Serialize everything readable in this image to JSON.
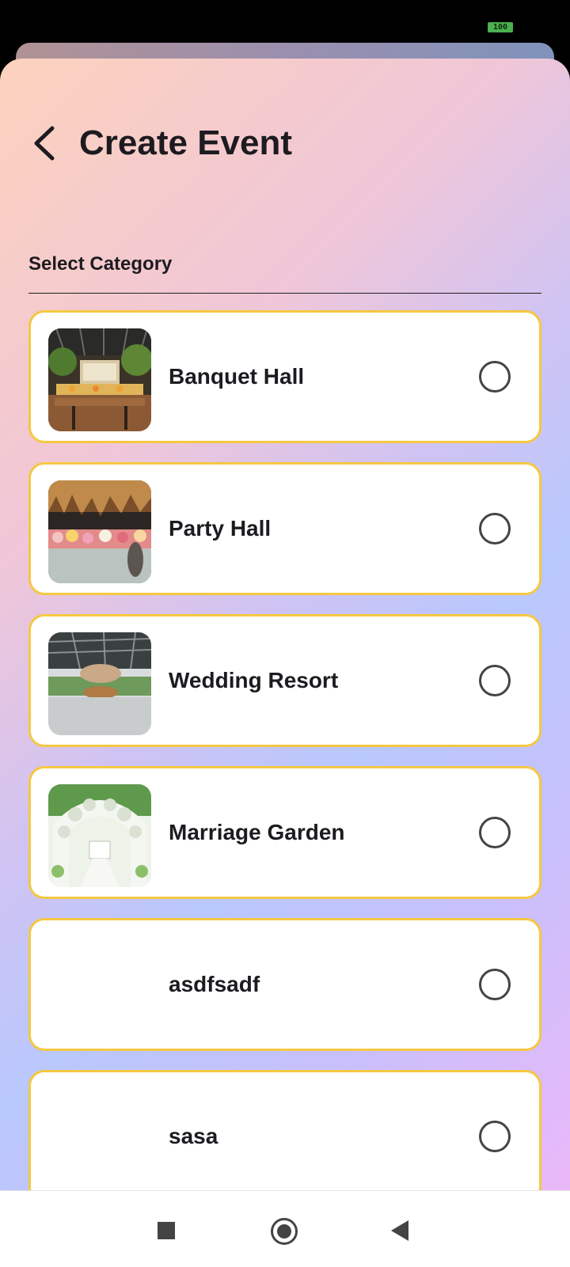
{
  "status_bar": {
    "battery": "100"
  },
  "header": {
    "title": "Create Event",
    "back_icon": "chevron-left-icon"
  },
  "section": {
    "label": "Select Category"
  },
  "categories": [
    {
      "label": "Banquet Hall",
      "image": "banquet-hall-photo",
      "selected": false
    },
    {
      "label": "Party Hall",
      "image": "party-hall-photo",
      "selected": false
    },
    {
      "label": "Wedding Resort",
      "image": "wedding-resort-photo",
      "selected": false
    },
    {
      "label": "Marriage Garden",
      "image": "marriage-garden-photo",
      "selected": false
    },
    {
      "label": "asdfsadf",
      "image": "",
      "selected": false
    },
    {
      "label": "sasa",
      "image": "",
      "selected": false
    }
  ],
  "nav": {
    "recents_icon": "square-icon",
    "home_icon": "circle-icon",
    "back_icon": "triangle-back-icon"
  },
  "colors": {
    "card_border": "#f5c842",
    "text": "#1d1b20",
    "nav_icon": "#444444"
  }
}
